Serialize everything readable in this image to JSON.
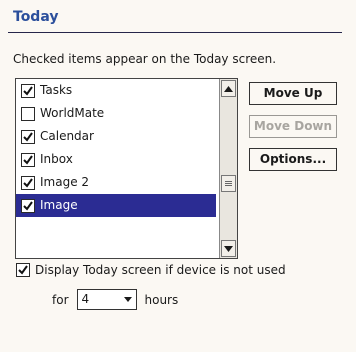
{
  "header": {
    "title": "Today"
  },
  "description": "Checked items appear on the Today screen.",
  "items": [
    {
      "label": "Tasks",
      "checked": true,
      "selected": false
    },
    {
      "label": "WorldMate",
      "checked": false,
      "selected": false
    },
    {
      "label": "Calendar",
      "checked": true,
      "selected": false
    },
    {
      "label": "Inbox",
      "checked": true,
      "selected": false
    },
    {
      "label": "Image 2",
      "checked": true,
      "selected": false
    },
    {
      "label": "Image",
      "checked": true,
      "selected": true
    }
  ],
  "buttons": {
    "move_up": "Move Up",
    "move_down": "Move Down",
    "options": "Options..."
  },
  "display_option": {
    "label": "Display Today screen if device is not used",
    "checked": true,
    "for_label": "for",
    "hours_value": "4",
    "hours_label": "hours"
  },
  "colors": {
    "title": "#2b4f9c",
    "selection": "#2b2c93",
    "background": "#fbf8f3"
  }
}
